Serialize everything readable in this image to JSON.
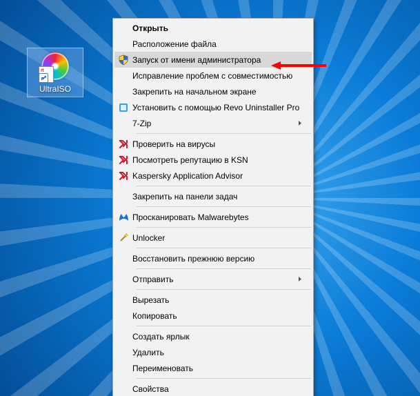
{
  "desktop": {
    "shortcut": {
      "label": "UltraISO",
      "selected": true
    }
  },
  "context_menu": {
    "items": [
      {
        "label": "Открыть",
        "bold": true,
        "icon": null
      },
      {
        "label": "Расположение файла",
        "icon": null
      },
      {
        "label": "Запуск от имени администратора",
        "icon": "shield",
        "highlight": true
      },
      {
        "label": "Исправление проблем с совместимостью",
        "icon": null
      },
      {
        "label": "Закрепить на начальном экране",
        "icon": null
      },
      {
        "label": "Установить с помощью Revo Uninstaller Pro",
        "icon": "revo"
      },
      {
        "label": "7-Zip",
        "icon": null,
        "submenu": true
      },
      {
        "sep": true
      },
      {
        "label": "Проверить на вирусы",
        "icon": "kasp"
      },
      {
        "label": "Посмотреть репутацию в KSN",
        "icon": "kasp"
      },
      {
        "label": "Kaspersky Application Advisor",
        "icon": "kasp"
      },
      {
        "sep": true
      },
      {
        "label": "Закрепить на панели задач",
        "icon": null
      },
      {
        "sep": true
      },
      {
        "label": "Просканировать Malwarebytes",
        "icon": "mbam"
      },
      {
        "sep": true
      },
      {
        "label": "Unlocker",
        "icon": "wand"
      },
      {
        "sep": true
      },
      {
        "label": "Восстановить прежнюю версию",
        "icon": null
      },
      {
        "sep": true
      },
      {
        "label": "Отправить",
        "icon": null,
        "submenu": true
      },
      {
        "sep": true
      },
      {
        "label": "Вырезать",
        "icon": null
      },
      {
        "label": "Копировать",
        "icon": null
      },
      {
        "sep": true
      },
      {
        "label": "Создать ярлык",
        "icon": null
      },
      {
        "label": "Удалить",
        "icon": null
      },
      {
        "label": "Переименовать",
        "icon": null
      },
      {
        "sep": true
      },
      {
        "label": "Свойства",
        "icon": null
      }
    ]
  },
  "annotation": {
    "arrow_color": "#ff0000"
  }
}
